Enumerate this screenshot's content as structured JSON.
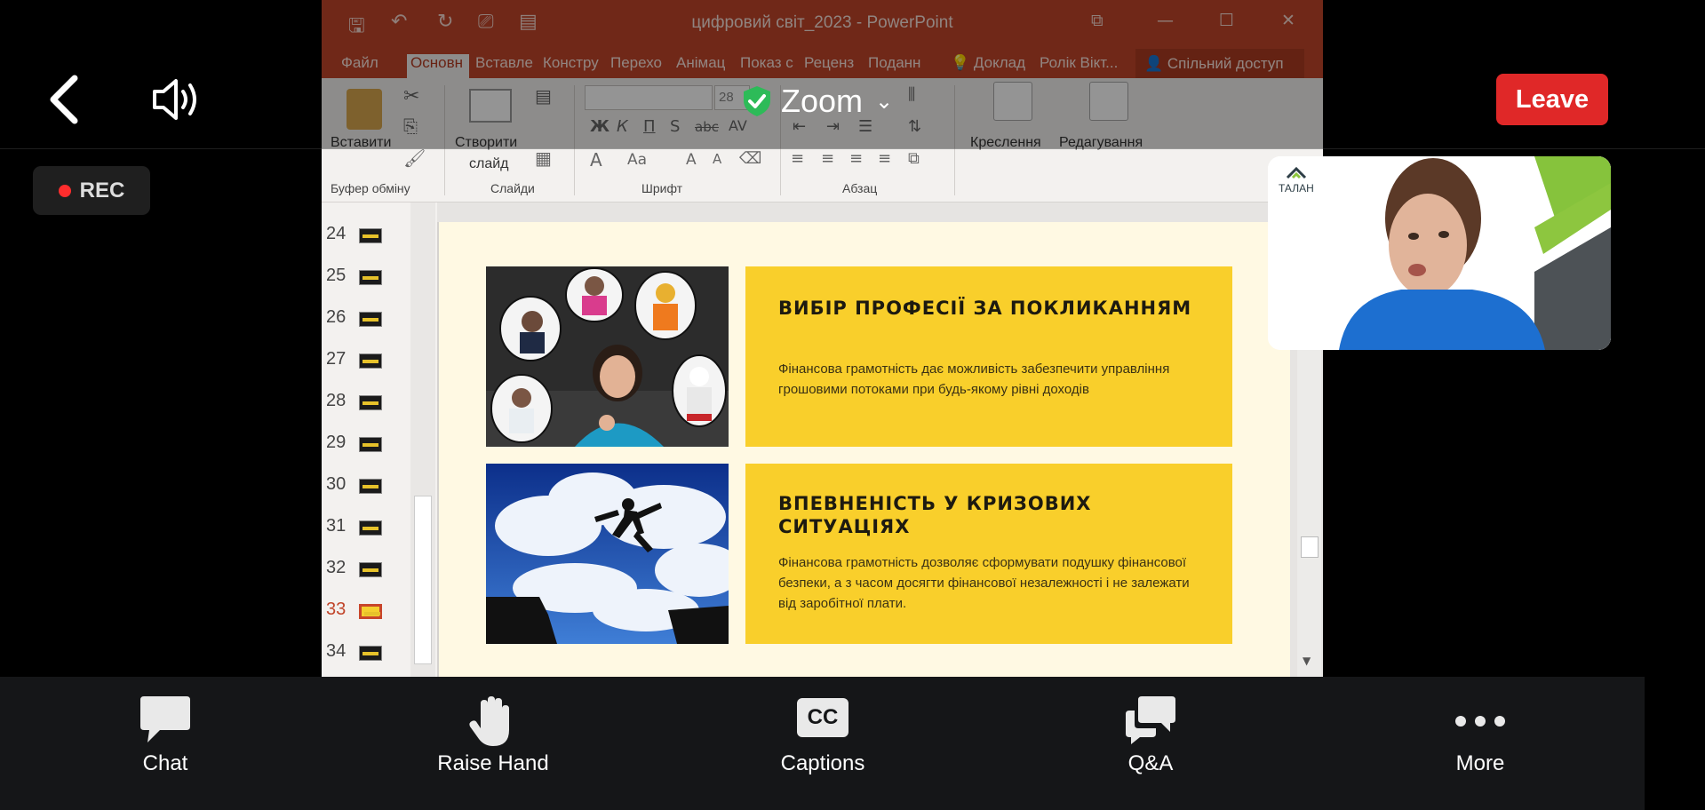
{
  "powerpoint": {
    "window_title": "цифровий світ_2023 - PowerPoint",
    "tabs": [
      "Файл",
      "Основн",
      "Вставле",
      "Констру",
      "Перехо",
      "Анімац",
      "Показ с",
      "Реценз",
      "Поданн"
    ],
    "tell_me": "Доклад",
    "user": "Ролік Вікт...",
    "share": "Спільний доступ",
    "ribbon": {
      "paste": "Вставити",
      "new_slide_line1": "Створити",
      "new_slide_line2": "слайд",
      "font_size": "28",
      "drawing": "Креслення",
      "editing": "Редагування",
      "groups": {
        "clipboard": "Буфер обміну",
        "slides": "Слайди",
        "font": "Шрифт",
        "paragraph": "Абзац"
      }
    },
    "thumbnails": [
      "24",
      "25",
      "26",
      "27",
      "28",
      "29",
      "30",
      "31",
      "32",
      "33",
      "34"
    ],
    "active_thumbnail": "33",
    "slide": {
      "card1": {
        "title": "ВИБІР ПРОФЕСІЇ ЗА ПОКЛИКАННЯМ",
        "body": "Фінансова грамотність дає можливість забезпечити управління грошовими потоками при будь-якому рівні доходів"
      },
      "card2": {
        "title": "ВПЕВНЕНІСТЬ У КРИЗОВИХ СИТУАЦІЯХ",
        "body": "Фінансова грамотність дозволяє сформувати подушку фінансової безпеки, а з часом досягти фінансової незалежності і не залежати від заробітної плати."
      }
    }
  },
  "zoom": {
    "brand": "Zoom",
    "leave": "Leave",
    "rec": "REC",
    "camera_logo": "ТАЛАН",
    "toolbar": {
      "chat": "Chat",
      "raise_hand": "Raise Hand",
      "captions": "Captions",
      "captions_badge": "CC",
      "qa": "Q&A",
      "more": "More"
    }
  },
  "colors": {
    "leave": "#e02828",
    "slide_card": "#f9cf2b",
    "ppt_accent": "#c1452a",
    "rec_dot": "#ff2d2d"
  }
}
